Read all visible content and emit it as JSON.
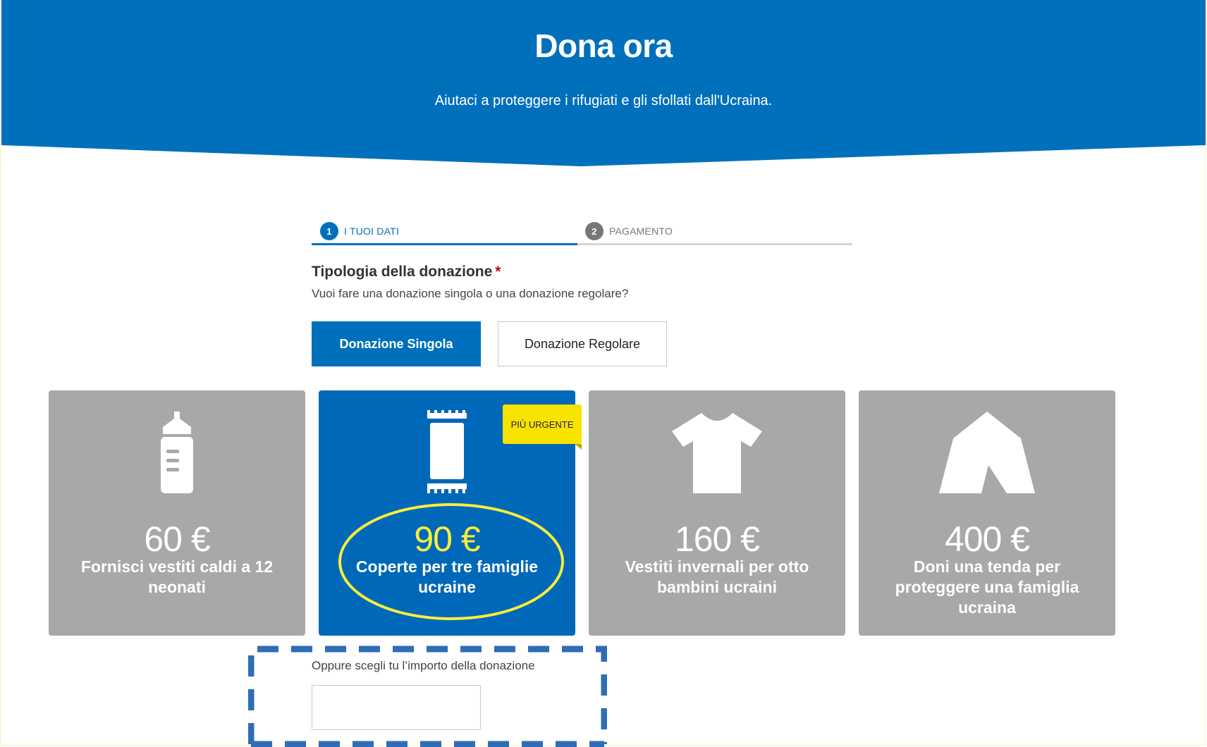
{
  "header": {
    "title": "Dona ora",
    "subtitle": "Aiutaci a proteggere i rifugiati e gli sfollati dall'Ucraina.",
    "background_color": "#0070bc"
  },
  "steps": [
    {
      "number": "1",
      "label": "I TUOI DATI",
      "active": true
    },
    {
      "number": "2",
      "label": "PAGAMENTO",
      "active": false
    }
  ],
  "donation_type": {
    "label": "Tipologia della donazione",
    "required_mark": "*",
    "help": "Vuoi fare una donazione singola o una donazione regolare?",
    "options": [
      {
        "label": "Donazione Singola",
        "selected": true
      },
      {
        "label": "Donazione Regolare",
        "selected": false
      }
    ]
  },
  "amount_cards": [
    {
      "icon": "baby-bottle-icon",
      "amount": "60 €",
      "description": "Fornisci vestiti caldi a 12 neonati",
      "selected": false
    },
    {
      "icon": "blanket-icon",
      "amount": "90 €",
      "description": "Coperte per tre famiglie ucraine",
      "selected": true,
      "badge": "PIÙ URGENTE"
    },
    {
      "icon": "tshirt-icon",
      "amount": "160 €",
      "description": "Vestiti invernali per otto bambini ucraini",
      "selected": false
    },
    {
      "icon": "tent-icon",
      "amount": "400 €",
      "description": "Doni una tenda per proteggere una famiglia ucraina",
      "selected": false
    }
  ],
  "custom_amount": {
    "label": "Oppure scegli tu l’importo della donazione",
    "value": "",
    "placeholder": ""
  },
  "colors": {
    "brand_blue": "#0070bc",
    "card_gray": "#a8a8a8",
    "card_selected": "#0068b8",
    "badge_yellow": "#f7e200",
    "highlight_yellow": "#f7ef3c",
    "annotation_blue": "#2f6db5"
  }
}
